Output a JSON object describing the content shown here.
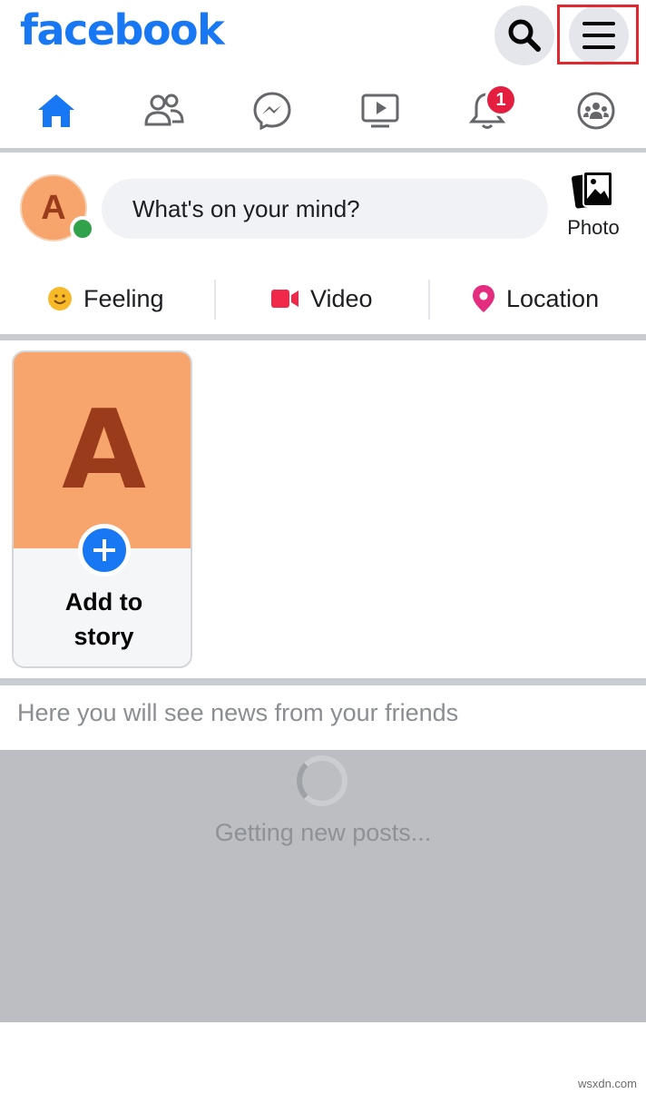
{
  "header": {
    "logo": "facebook",
    "search_icon": "search-icon",
    "menu_icon": "hamburger-menu-icon"
  },
  "tabs": [
    {
      "name": "home",
      "icon": "home-icon",
      "active": true
    },
    {
      "name": "friends",
      "icon": "friends-icon"
    },
    {
      "name": "messenger",
      "icon": "messenger-icon"
    },
    {
      "name": "watch",
      "icon": "video-icon"
    },
    {
      "name": "notifications",
      "icon": "bell-icon",
      "badge": "1"
    },
    {
      "name": "groups",
      "icon": "groups-icon"
    }
  ],
  "composer": {
    "avatar_letter": "A",
    "placeholder": "What's on your mind?",
    "photo_label": "Photo"
  },
  "actions": {
    "feeling": "Feeling",
    "video": "Video",
    "location": "Location"
  },
  "story": {
    "letter": "A",
    "label_line1": "Add to",
    "label_line2": "story"
  },
  "news": {
    "message": "Here you will see news from your friends",
    "loading": "Getting new posts..."
  },
  "watermark": "wsxdn.com",
  "colors": {
    "brand_blue": "#1877f2",
    "badge_red": "#e41e3f",
    "online_green": "#31a24c",
    "avatar_orange": "#f7a56c"
  }
}
